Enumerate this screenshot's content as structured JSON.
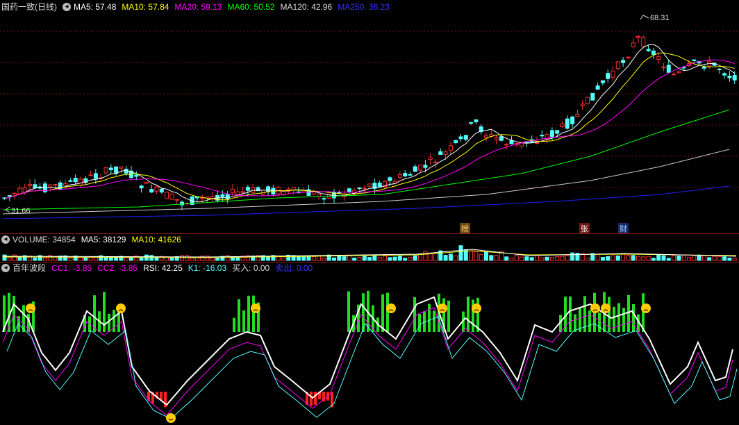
{
  "main": {
    "title": "国药一致(日线)",
    "ma_labels": [
      {
        "text": "MA5: 57.48",
        "color": "#ffffff"
      },
      {
        "text": "MA10: 57.84",
        "color": "#ffff00"
      },
      {
        "text": "MA20: 59.13",
        "color": "#ff00ff"
      },
      {
        "text": "MA60: 50.52",
        "color": "#00ff00"
      },
      {
        "text": "MA120: 42.96",
        "color": "#dddddd"
      },
      {
        "text": "MA250: 36.23",
        "color": "#3333ff"
      }
    ],
    "high_label": "68.31",
    "low_label": "31.66",
    "event_tags": [
      "榜",
      "张",
      "财"
    ]
  },
  "volume": {
    "label": "VOLUME: 34854",
    "ma5": "MA5: 38129",
    "ma10": "MA10: 41626"
  },
  "indicator": {
    "name": "百年波段",
    "cc1": "CC1: -3.85",
    "cc2": "CC2: -3.85",
    "rsi": "RSI: 42.25",
    "k1": "K1: -16.03",
    "buy": "买入: 0.00",
    "sell": "卖出: 0.00"
  },
  "colors": {
    "up": "#ff3030",
    "down": "#54ffff",
    "grid": "#7a1010",
    "ma5": "#ffffff",
    "ma10": "#ffff00",
    "ma20": "#ff00ff",
    "ma60": "#00ff00",
    "ma120": "#cccccc",
    "ma250": "#2020ff"
  },
  "icons": [
    "collapse-icon",
    "frown-face-icon",
    "smile-face-icon"
  ]
}
